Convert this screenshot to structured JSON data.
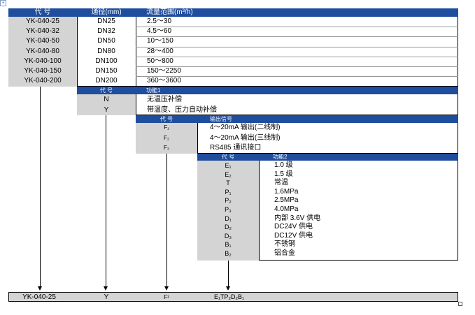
{
  "table1": {
    "headers": [
      "代 号",
      "通径(mm)",
      "流量范围(m³/h)"
    ],
    "rows": [
      [
        "YK-040-25",
        "DN25",
        "2.5～30"
      ],
      [
        "YK-040-32",
        "DN32",
        "4.5～60"
      ],
      [
        "YK-040-50",
        "DN50",
        "10～150"
      ],
      [
        "YK-040-80",
        "DN80",
        "28～400"
      ],
      [
        "YK-040-100",
        "DN100",
        "50～800"
      ],
      [
        "YK-040-150",
        "DN150",
        "150～2250"
      ],
      [
        "YK-040-200",
        "DN200",
        "360～3600"
      ]
    ]
  },
  "table2": {
    "headers": [
      "代 号",
      "功能1"
    ],
    "rows": [
      [
        "N",
        "无温压补偿"
      ],
      [
        "Y",
        "带温度、压力自动补偿"
      ]
    ]
  },
  "table3": {
    "headers": [
      "代 号",
      "输出信号"
    ],
    "rows": [
      [
        "F₁",
        "4～20mA 输出(二线制)"
      ],
      [
        "F₂",
        "4～20mA 输出(三线制)"
      ],
      [
        "F₃",
        "RS485 通讯接口"
      ]
    ]
  },
  "table4": {
    "headers": [
      "代 号",
      "功能2"
    ],
    "rows": [
      [
        "E₁",
        "1.0 级"
      ],
      [
        "E₂",
        "1.5 级"
      ],
      [
        "T",
        "常温"
      ],
      [
        "P₁",
        "1.6MPa"
      ],
      [
        "P₂",
        "2.5MPa"
      ],
      [
        "P₃",
        "4.0MPa"
      ],
      [
        "D₁",
        "内部 3.6V 供电"
      ],
      [
        "D₂",
        "DC24V 供电"
      ],
      [
        "D₃",
        "DC12V 供电"
      ],
      [
        "B₁",
        "不锈钢"
      ],
      [
        "B₂",
        "铝合金"
      ]
    ]
  },
  "example": [
    "YK-040-25",
    "Y",
    "F¹",
    "E₁TP₂D₂B₁"
  ]
}
